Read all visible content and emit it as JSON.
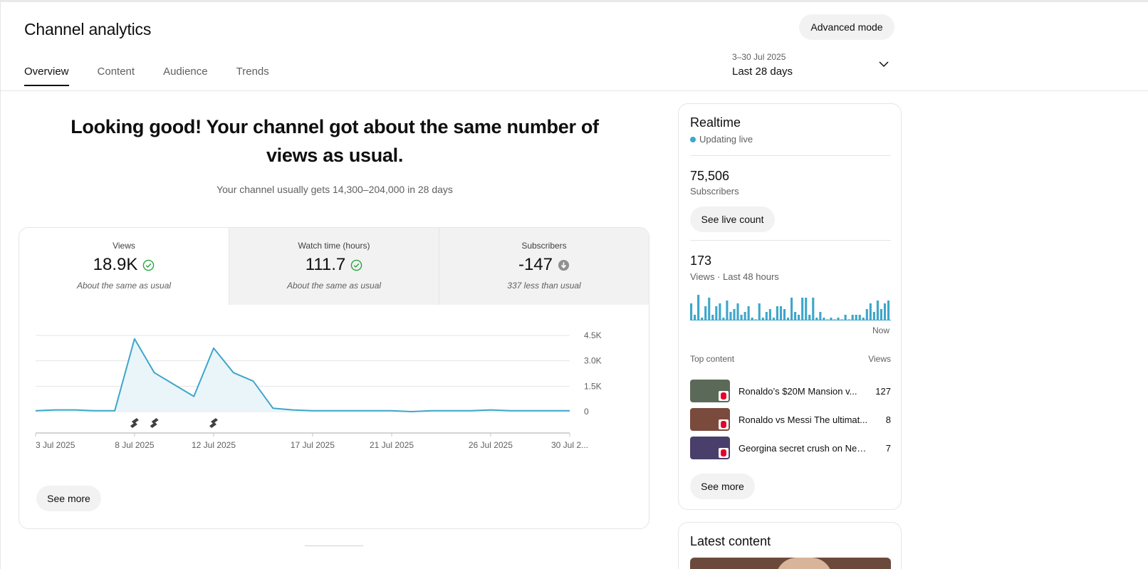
{
  "header": {
    "title": "Channel analytics",
    "advanced_mode_label": "Advanced mode"
  },
  "tabs": [
    {
      "label": "Overview",
      "active": true
    },
    {
      "label": "Content",
      "active": false
    },
    {
      "label": "Audience",
      "active": false
    },
    {
      "label": "Trends",
      "active": false
    }
  ],
  "date_range": {
    "range": "3–30 Jul 2025",
    "label": "Last 28 days",
    "icon": "chevron-down-icon"
  },
  "summary": {
    "headline": "Looking good! Your channel got about the same number of views as usual.",
    "subtext": "Your channel usually gets 14,300–204,000 in 28 days"
  },
  "metrics": [
    {
      "label": "Views",
      "value": "18.9K",
      "note": "About the same as usual",
      "status_icon": "check-circle-icon",
      "status_color": "#2ba640",
      "active": true
    },
    {
      "label": "Watch time (hours)",
      "value": "111.7",
      "note": "About the same as usual",
      "status_icon": "check-circle-icon",
      "status_color": "#2ba640",
      "active": false
    },
    {
      "label": "Subscribers",
      "value": "-147",
      "note": "337 less than usual",
      "status_icon": "arrow-down-circle-icon",
      "status_color": "#909090",
      "active": false
    }
  ],
  "chart_data": {
    "type": "area",
    "x": [
      "3 Jul 2025",
      "4 Jul 2025",
      "5 Jul 2025",
      "6 Jul 2025",
      "7 Jul 2025",
      "8 Jul 2025",
      "9 Jul 2025",
      "10 Jul 2025",
      "11 Jul 2025",
      "12 Jul 2025",
      "13 Jul 2025",
      "14 Jul 2025",
      "15 Jul 2025",
      "16 Jul 2025",
      "17 Jul 2025",
      "18 Jul 2025",
      "19 Jul 2025",
      "20 Jul 2025",
      "21 Jul 2025",
      "22 Jul 2025",
      "23 Jul 2025",
      "24 Jul 2025",
      "25 Jul 2025",
      "26 Jul 2025",
      "27 Jul 2025",
      "28 Jul 2025",
      "29 Jul 2025",
      "30 Jul 2025"
    ],
    "series": [
      {
        "values": [
          50,
          100,
          100,
          50,
          50,
          4300,
          2300,
          1600,
          900,
          3750,
          2300,
          1800,
          200,
          100,
          50,
          50,
          50,
          50,
          50,
          0,
          50,
          50,
          50,
          100,
          50,
          50,
          50,
          50
        ]
      }
    ],
    "x_tick_labels": [
      "3 Jul 2025",
      "8 Jul 2025",
      "12 Jul 2025",
      "17 Jul 2025",
      "21 Jul 2025",
      "26 Jul 2025",
      "30 Jul 2..."
    ],
    "x_tick_index": [
      0,
      5,
      9,
      14,
      18,
      23,
      27
    ],
    "y_ticks": [
      "0",
      "1.5K",
      "3.0K",
      "4.5K"
    ],
    "ylim": [
      0,
      4500
    ],
    "short_markers_at": [
      "8 Jul 2025",
      "9 Jul 2025",
      "12 Jul 2025"
    ],
    "line_color": "#3ea6ca",
    "fill_color": "#eaf5f9"
  },
  "card_see_more": "See more",
  "realtime": {
    "title": "Realtime",
    "status": "Updating live",
    "subscribers_value": "75,506",
    "subscribers_label": "Subscribers",
    "live_count_label": "See live count",
    "views_value": "173",
    "views_label": "Views · Last 48 hours",
    "hourly_views": [
      6,
      2,
      9,
      1,
      5,
      8,
      2,
      5,
      6,
      1,
      7,
      3,
      4,
      6,
      2,
      3,
      5,
      1,
      0,
      6,
      1,
      3,
      4,
      1,
      5,
      5,
      4,
      1,
      8,
      3,
      2,
      8,
      8,
      2,
      8,
      1,
      3,
      1,
      0,
      1,
      0,
      1,
      0,
      2,
      0,
      2,
      2,
      2,
      1,
      4,
      6,
      3,
      7,
      4,
      6,
      7
    ],
    "bar_color": "#3ea6ca",
    "now_label": "Now",
    "top_content_label": "Top content",
    "views_col_label": "Views",
    "top_content": [
      {
        "title": "Ronaldo’s $20M Mansion v...",
        "views": "127",
        "thumb_color": "#5b6a58"
      },
      {
        "title": "Ronaldo vs Messi The ultimat...",
        "views": "8",
        "thumb_color": "#7a4b3c"
      },
      {
        "title": "Georgina secret crush on Ney...",
        "views": "7",
        "thumb_color": "#4a3f6b"
      }
    ],
    "see_more_label": "See more"
  },
  "latest_content": {
    "title": "Latest content"
  }
}
